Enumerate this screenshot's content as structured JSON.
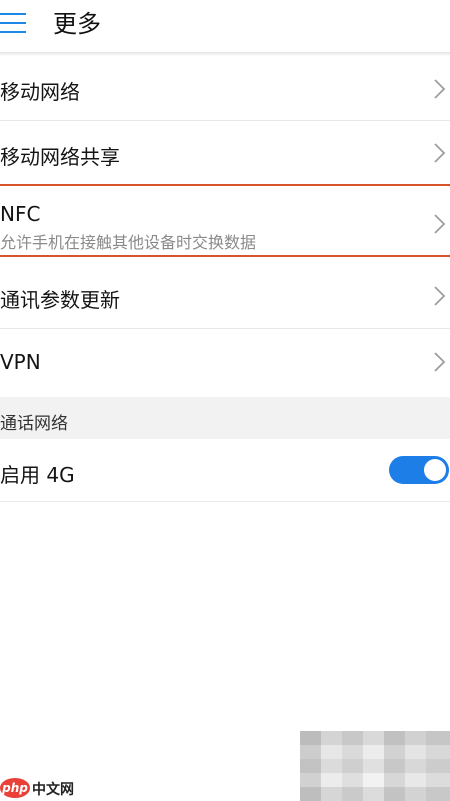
{
  "header": {
    "title": "更多",
    "menu_icon": "hamburger-menu-icon",
    "accent_color": "#1e88e5"
  },
  "items": [
    {
      "label": "移动网络"
    },
    {
      "label": "移动网络共享"
    },
    {
      "label": "NFC",
      "sublabel": "允许手机在接触其他设备时交换数据"
    },
    {
      "label": "通讯参数更新"
    },
    {
      "label": "VPN"
    }
  ],
  "section": {
    "title": "通话网络",
    "toggle_item": {
      "label": "启用 4G",
      "enabled": true,
      "toggle_color": "#1e7ee8"
    }
  },
  "watermark": {
    "badge": "php",
    "text": "中文网"
  }
}
